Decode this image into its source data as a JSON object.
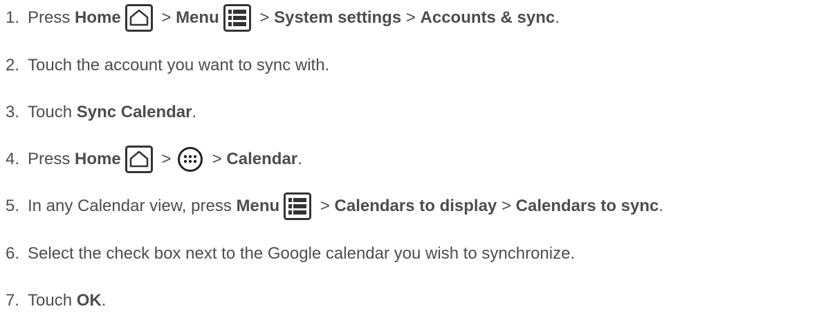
{
  "steps": [
    {
      "number": "1.",
      "parts": [
        "Press ",
        "Home",
        " > ",
        "Menu",
        " > ",
        "System settings",
        " > ",
        "Accounts & sync",
        "."
      ]
    },
    {
      "number": "2.",
      "text": "Touch the account you want to sync with."
    },
    {
      "number": "3.",
      "parts": [
        "Touch ",
        "Sync Calendar",
        "."
      ]
    },
    {
      "number": "4.",
      "parts": [
        "Press ",
        "Home",
        " > ",
        " > ",
        "Calendar",
        "."
      ]
    },
    {
      "number": "5.",
      "parts": [
        "In any Calendar view, press ",
        "Menu",
        " > ",
        "Calendars to display",
        " > ",
        "Calendars to sync",
        "."
      ]
    },
    {
      "number": "6.",
      "text": "Select the check box next to the Google calendar you wish to synchronize."
    },
    {
      "number": "7.",
      "parts": [
        "Touch ",
        "OK",
        "."
      ]
    }
  ],
  "icons": {
    "home": "home-icon",
    "menu": "menu-icon",
    "apps": "apps-icon"
  },
  "colors": {
    "text": "#4d4d4d",
    "icon": "#333333"
  }
}
